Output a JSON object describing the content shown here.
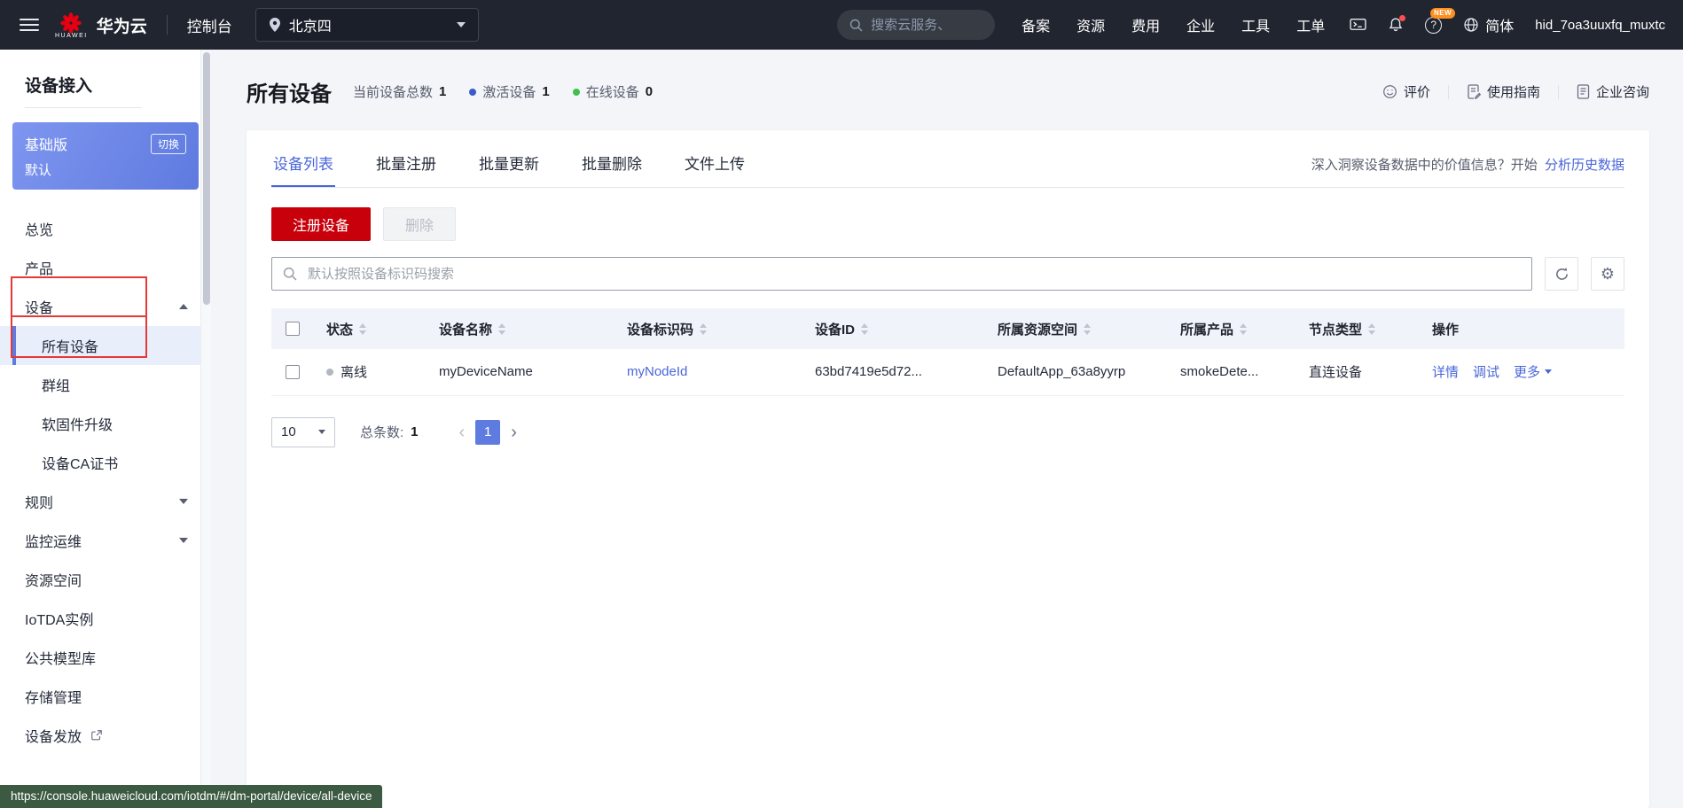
{
  "topbar": {
    "logo_subtext": "HUAWEI",
    "brand": "华为云",
    "console_label": "控制台",
    "region": "北京四",
    "search_placeholder": "搜索云服务、",
    "nav_items": [
      "备案",
      "资源",
      "费用",
      "企业",
      "工具",
      "工单"
    ],
    "help_glyph": "?",
    "new_badge": "NEW",
    "lang": "简体",
    "username": "hid_7oa3uuxfq_muxtc"
  },
  "sidebar": {
    "title": "设备接入",
    "edition": {
      "name": "基础版",
      "switch_label": "切换",
      "instance": "默认"
    },
    "items": [
      {
        "label": "总览"
      },
      {
        "label": "产品"
      },
      {
        "label": "设备"
      },
      {
        "label": "所有设备"
      },
      {
        "label": "群组"
      },
      {
        "label": "软固件升级"
      },
      {
        "label": "设备CA证书"
      },
      {
        "label": "规则"
      },
      {
        "label": "监控运维"
      },
      {
        "label": "资源空间"
      },
      {
        "label": "IoTDA实例"
      },
      {
        "label": "公共模型库"
      },
      {
        "label": "存储管理"
      },
      {
        "label": "设备发放"
      }
    ]
  },
  "page": {
    "title": "所有设备",
    "stats": [
      {
        "label": "当前设备总数",
        "value": "1"
      },
      {
        "label": "激活设备",
        "value": "1"
      },
      {
        "label": "在线设备",
        "value": "0"
      }
    ],
    "actions": [
      "评价",
      "使用指南",
      "企业咨询"
    ]
  },
  "tabs": [
    "设备列表",
    "批量注册",
    "批量更新",
    "批量删除",
    "文件上传"
  ],
  "insight": {
    "text": "深入洞察设备数据中的价值信息？开始",
    "link": "分析历史数据"
  },
  "toolbar": {
    "register_label": "注册设备",
    "delete_label": "删除",
    "search_placeholder": "默认按照设备标识码搜索",
    "gear_glyph": "⚙"
  },
  "table": {
    "columns": [
      "状态",
      "设备名称",
      "设备标识码",
      "设备ID",
      "所属资源空间",
      "所属产品",
      "节点类型",
      "操作"
    ],
    "rows": [
      {
        "status": "离线",
        "name": "myDeviceName",
        "node_id": "myNodeId",
        "device_id": "63bd7419e5d72...",
        "resource_space": "DefaultApp_63a8yyrp",
        "product": "smokeDete...",
        "node_type": "直连设备",
        "actions": [
          "详情",
          "调试",
          "更多"
        ]
      }
    ]
  },
  "pagination": {
    "page_size": "10",
    "total_label": "总条数:",
    "total": "1",
    "page": "1",
    "prev_glyph": "‹",
    "next_glyph": "›"
  },
  "statusbar_url": "https://console.huaweicloud.com/iotdm/#/dm-portal/device/all-device",
  "colors": {
    "accent_blue": "#4a66d8",
    "brand_red": "#c7000b",
    "activated_dot": "#3a5bc8",
    "online_dot": "#3fbf4e",
    "offline_dot": "#b3b7bf",
    "annotation_red": "#e53935"
  }
}
